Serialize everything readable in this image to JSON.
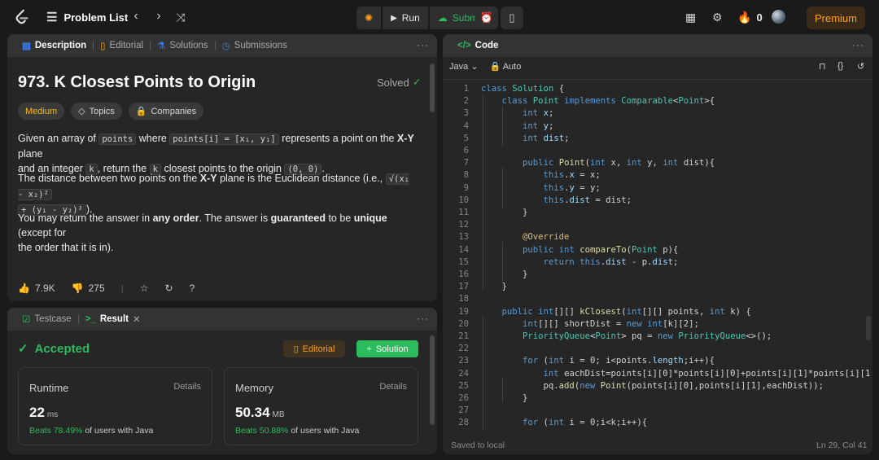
{
  "topbar": {
    "problem_list": "Problem List",
    "run": "Run",
    "submit": "Submit",
    "streak": "0",
    "premium": "Premium"
  },
  "description": {
    "tabs": [
      "Description",
      "Editorial",
      "Solutions",
      "Submissions"
    ],
    "title": "973. K Closest Points to Origin",
    "solved": "Solved",
    "chips": [
      "Medium",
      "Topics",
      "Companies"
    ],
    "p1": {
      "a": "Given an array of ",
      "code1": "points",
      "b": " where ",
      "code2": "points[i] = [x₁, y₁]",
      "c": " represents a point on the ",
      "bold": "X-Y",
      "d": " plane",
      "e": "and an integer ",
      "code3": "k",
      "f": ", return the ",
      "code4": "k",
      "g": " closest points to the origin ",
      "code5": "(0, 0)",
      "h": "."
    },
    "p2": {
      "a": "The distance between two points on the ",
      "bold": "X-Y",
      "b": " plane is the Euclidean distance (i.e., ",
      "code1": "√(x₁ - x₂)²",
      "code2": "+ (y₁ - y₂)²",
      "c": ")."
    },
    "p3": {
      "a": "You may return the answer in ",
      "b1": "any order",
      "b": ". The answer is ",
      "b2": "guaranteed",
      "c": " to be ",
      "b3": "unique",
      "d": " (except for",
      "e": "the order that it is in)."
    },
    "likes": "7.9K",
    "dislikes": "275"
  },
  "result": {
    "tabs": [
      "Testcase",
      "Result"
    ],
    "status": "Accepted",
    "editorial": "Editorial",
    "solution": "Solution",
    "runtime": {
      "label": "Runtime",
      "details": "Details",
      "value": "22",
      "unit": "ms",
      "beats": "Beats 78.49%",
      "suffix": "of users with Java"
    },
    "memory": {
      "label": "Memory",
      "details": "Details",
      "value": "50.34",
      "unit": "MB",
      "beats": "Beats 50.88%",
      "suffix": "of users with Java"
    }
  },
  "code": {
    "tab": "Code",
    "language": "Java",
    "mode": "Auto",
    "status": "Saved to local",
    "cursor": "Ln 29, Col 41"
  }
}
